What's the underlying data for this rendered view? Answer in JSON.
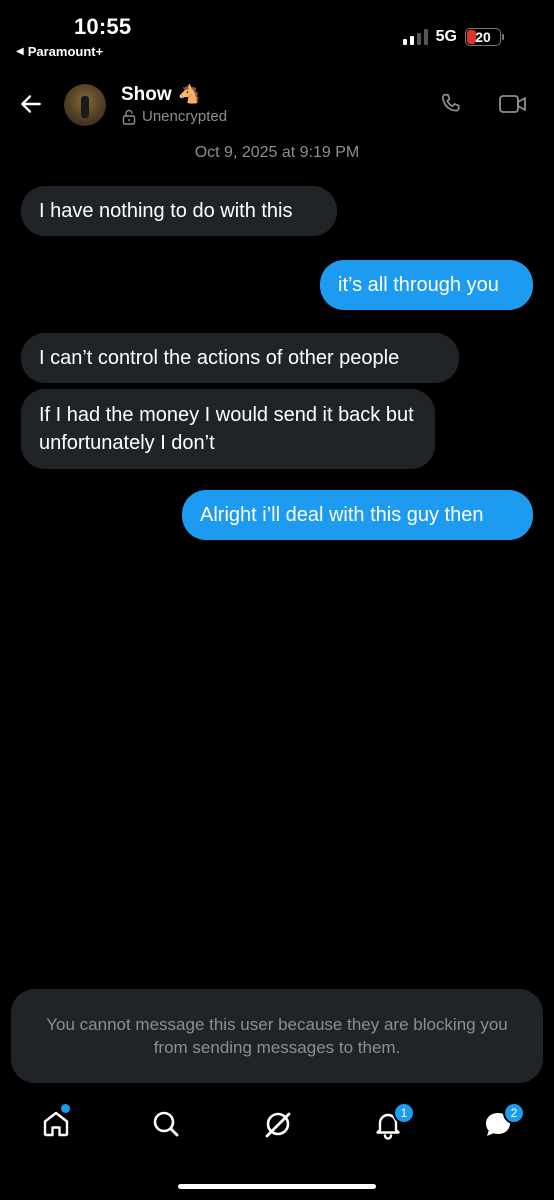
{
  "status_bar": {
    "time": "10:55",
    "back_app": "Paramount+",
    "network": "5G",
    "battery": "20",
    "battery_color": "#e0342a"
  },
  "header": {
    "contact_name": "Show",
    "contact_emoji": "🐴",
    "encryption_status": "Unencrypted",
    "icons": [
      "back-arrow-icon",
      "phone-icon",
      "video-icon",
      "lock-open-icon"
    ]
  },
  "thread": {
    "date": "Oct 9, 2025 at 9:19 PM",
    "messages": [
      {
        "direction": "in",
        "text": "I have nothing to do with this"
      },
      {
        "direction": "out",
        "text": "it’s all through you"
      },
      {
        "direction": "in",
        "text": "I can’t control the actions of other people"
      },
      {
        "direction": "in",
        "text": "If I had the money I would send it back but unfortunately I don’t"
      },
      {
        "direction": "out",
        "text": "Alright i’ll deal with this guy then"
      }
    ]
  },
  "blocked_notice": "You cannot message this user because they are blocking you from sending messages to them.",
  "bottom_nav": {
    "items": [
      "home-icon",
      "search-icon",
      "grok-icon",
      "bell-icon",
      "messages-icon"
    ],
    "notifications_badge": "1",
    "messages_badge": "2"
  },
  "colors": {
    "accent": "#1d9bf0",
    "incoming_bubble": "#202327",
    "muted_text": "#8b8f94",
    "background": "#000000"
  }
}
